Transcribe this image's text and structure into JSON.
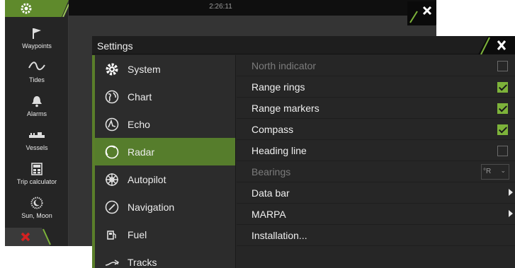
{
  "status_bar": {
    "time": "2:26:11"
  },
  "left_panel": {
    "items": [
      {
        "label": "Waypoints",
        "icon": "flag-icon"
      },
      {
        "label": "Tides",
        "icon": "wave-icon"
      },
      {
        "label": "Alarms",
        "icon": "bell-icon"
      },
      {
        "label": "Vessels",
        "icon": "vessel-icon"
      },
      {
        "label": "Trip calculator",
        "icon": "calculator-icon"
      },
      {
        "label": "Sun, Moon",
        "icon": "sun-moon-icon"
      }
    ]
  },
  "settings": {
    "title": "Settings",
    "menu": [
      {
        "label": "System",
        "icon": "gear-icon"
      },
      {
        "label": "Chart",
        "icon": "globe-icon"
      },
      {
        "label": "Echo",
        "icon": "sonar-icon"
      },
      {
        "label": "Radar",
        "icon": "radar-icon",
        "selected": true
      },
      {
        "label": "Autopilot",
        "icon": "helm-icon"
      },
      {
        "label": "Navigation",
        "icon": "compass-icon"
      },
      {
        "label": "Fuel",
        "icon": "fuel-pump-icon"
      },
      {
        "label": "Tracks",
        "icon": "tracks-icon"
      }
    ],
    "options": [
      {
        "label": "North indicator",
        "type": "checkbox",
        "checked": false,
        "enabled": false
      },
      {
        "label": "Range rings",
        "type": "checkbox",
        "checked": true,
        "enabled": true
      },
      {
        "label": "Range markers",
        "type": "checkbox",
        "checked": true,
        "enabled": true
      },
      {
        "label": "Compass",
        "type": "checkbox",
        "checked": true,
        "enabled": true
      },
      {
        "label": "Heading line",
        "type": "checkbox",
        "checked": false,
        "enabled": true
      },
      {
        "label": "Bearings",
        "type": "select",
        "value": "°R",
        "enabled": false
      },
      {
        "label": "Data bar",
        "type": "submenu",
        "enabled": true
      },
      {
        "label": "MARPA",
        "type": "submenu",
        "enabled": true
      },
      {
        "label": "Installation...",
        "type": "action",
        "enabled": true
      }
    ]
  },
  "colors": {
    "accent_green": "#567d2c",
    "check_green": "#7db33a",
    "close_red": "#d32020"
  }
}
